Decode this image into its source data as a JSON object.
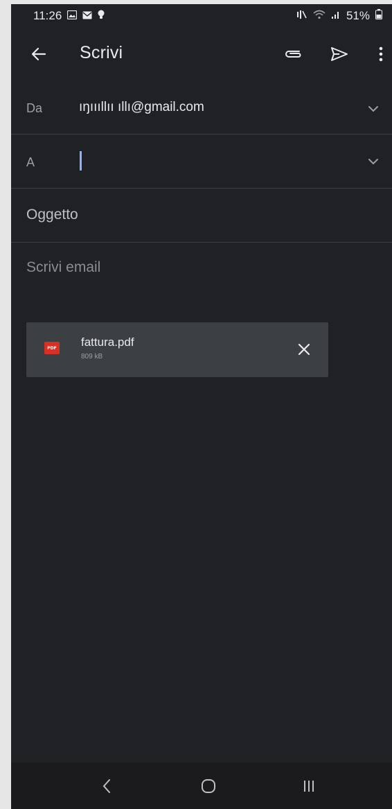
{
  "status_bar": {
    "time": "11:26",
    "battery": "51%",
    "left_icons": [
      "gallery-icon",
      "mail-icon",
      "lightbulb-icon"
    ],
    "right_icons": [
      "mute-icon",
      "wifi-icon",
      "signal-icon",
      "battery-icon"
    ]
  },
  "app_bar": {
    "title": "Scrivi",
    "icons": [
      "back-arrow-icon",
      "attach-icon",
      "send-icon",
      "more-vert-icon"
    ]
  },
  "from": {
    "label": "Da",
    "value": "ıŋıııllıı ıllı@gmail.com"
  },
  "to": {
    "label": "A",
    "value": ""
  },
  "subject": {
    "placeholder": "Oggetto"
  },
  "body": {
    "placeholder": "Scrivi email"
  },
  "attachment": {
    "name": "fattura.pdf",
    "size": "809 kB",
    "type_badge": "PDF"
  },
  "nav_bar": {
    "icons": [
      "nav-back-icon",
      "nav-home-icon",
      "nav-recents-icon"
    ]
  },
  "colors": {
    "background": "#202124",
    "text": "#e8eaed",
    "muted": "#9aa0a6",
    "accent": "#8ab4f8",
    "pdf_red": "#d93025",
    "attachment_bg": "#3c4043"
  }
}
